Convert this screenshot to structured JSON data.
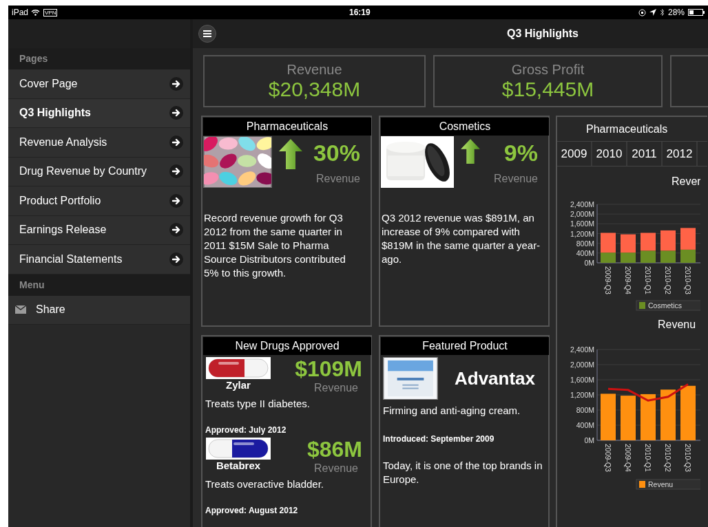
{
  "status_bar": {
    "device": "iPad",
    "vpn": "VPN",
    "time": "16:19",
    "battery": "28%"
  },
  "header": {
    "title": "Q3 Highlights"
  },
  "sidebar": {
    "sections": [
      {
        "heading": "Pages",
        "items": [
          {
            "kind": "page",
            "label": "Cover Page",
            "selected": false
          },
          {
            "kind": "page",
            "label": "Q3 Highlights",
            "selected": true
          },
          {
            "kind": "page",
            "label": "Revenue Analysis",
            "selected": false
          },
          {
            "kind": "page",
            "label": "Drug Revenue by Country",
            "selected": false
          },
          {
            "kind": "page",
            "label": "Product Portfolio",
            "selected": false
          },
          {
            "kind": "page",
            "label": "Earnings Release",
            "selected": false
          },
          {
            "kind": "page",
            "label": "Financial Statements",
            "selected": false
          }
        ]
      },
      {
        "heading": "Menu",
        "items": [
          {
            "kind": "share",
            "label": "Share",
            "selected": false
          }
        ]
      }
    ]
  },
  "kpis": [
    {
      "label": "Revenue",
      "value": "$20,348M"
    },
    {
      "label": "Gross Profit",
      "value": "$15,445M"
    }
  ],
  "tiles": [
    {
      "kind": "growth",
      "title": "Pharmaceuticals",
      "value": "30%",
      "caption": "Revenue",
      "text": "Record revenue growth for Q3 2012 from the same quarter in 2011 $15M Sale to Pharma Source Distributors contributed 5% to this growth."
    },
    {
      "kind": "growth",
      "title": "Cosmetics",
      "value": "9%",
      "caption": "Revenue",
      "text": "Q3 2012 revenue was $891M, an increase of 9% compared with $819M in the same quarter a year-ago."
    },
    {
      "kind": "drugs",
      "title": "New Drugs Approved",
      "drugs": [
        {
          "name": "Zylar",
          "value": "$109M",
          "caption": "Revenue",
          "description": "Treats type II diabetes.",
          "approved": "Approved: July 2012"
        },
        {
          "name": "Betabrex",
          "value": "$86M",
          "caption": "Revenue",
          "description": "Treats overactive bladder.",
          "approved": "Approved: August 2012"
        }
      ]
    },
    {
      "kind": "featured",
      "title": "Featured Product",
      "name": "Advantax",
      "description": "Firming and anti-aging cream.",
      "introduced": "Introduced: September 2009",
      "text": "Today, it is one of the top brands in Europe."
    }
  ],
  "detail": {
    "title": "Pharmaceuticals",
    "year_tabs": [
      {
        "label": "2009",
        "selected": false
      },
      {
        "label": "2010",
        "selected": false
      },
      {
        "label": "2011",
        "selected": false
      },
      {
        "label": "2012",
        "selected": false
      }
    ],
    "charts": [
      {
        "chart_data": {
          "type": "bar",
          "title": "Rever",
          "stacked": true,
          "grid": true,
          "categories": [
            "2009-Q3",
            "2009-Q4",
            "2010-Q1",
            "2010-Q2",
            "2010-Q3"
          ],
          "series": [
            {
              "name": "Cosmetics",
              "color": "#6b8e23",
              "values": [
                420,
                420,
                500,
                500,
                540
              ]
            },
            {
              "color": "#ff6347",
              "values": [
                810,
                750,
                730,
                830,
                890
              ]
            }
          ],
          "ylim": [
            0,
            2400
          ],
          "yticks": [
            {
              "value": 0,
              "label": "0M"
            },
            {
              "value": 400,
              "label": "400M"
            },
            {
              "value": 800,
              "label": "800M"
            },
            {
              "value": 1200,
              "label": "1,200M"
            },
            {
              "value": 1600,
              "label": "1,600M"
            },
            {
              "value": 2000,
              "label": "2,000M"
            },
            {
              "value": 2400,
              "label": "2,400M"
            }
          ]
        }
      },
      {
        "chart_data": {
          "type": "bar",
          "title": "Revenu",
          "grid": true,
          "categories": [
            "2009-Q3",
            "2009-Q4",
            "2010-Q1",
            "2010-Q2",
            "2010-Q3"
          ],
          "series": [
            {
              "name": "Revenu",
              "color": "#ff9010",
              "values": [
                1230,
                1180,
                1220,
                1340,
                1440
              ]
            },
            {
              "type": "line",
              "color": "#cc1111",
              "values": [
                1360,
                1330,
                1050,
                1150,
                1480
              ]
            }
          ],
          "ylim": [
            0,
            2400
          ],
          "yticks": [
            {
              "value": 0,
              "label": "0M"
            },
            {
              "value": 400,
              "label": "400M"
            },
            {
              "value": 800,
              "label": "800M"
            },
            {
              "value": 1200,
              "label": "1,200M"
            },
            {
              "value": 1600,
              "label": "1,600M"
            },
            {
              "value": 2000,
              "label": "2,000M"
            },
            {
              "value": 2400,
              "label": "2,400M"
            }
          ]
        }
      }
    ]
  }
}
